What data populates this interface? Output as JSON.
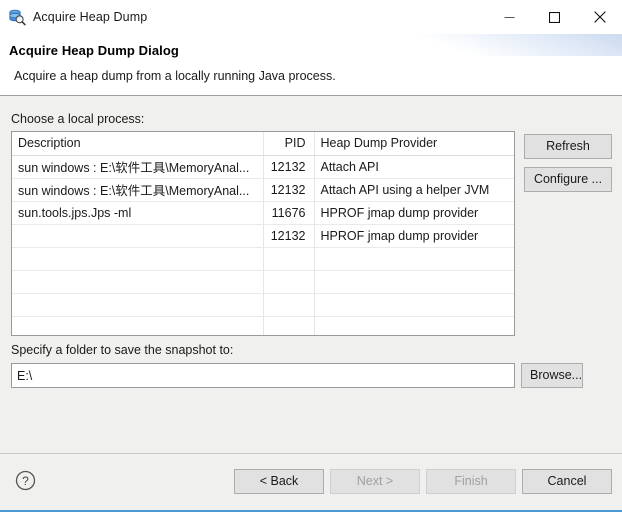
{
  "window": {
    "title": "Acquire Heap Dump",
    "icon": "heap-dump-search-icon",
    "controls": {
      "minimize": "minimize-icon",
      "maximize": "maximize-icon",
      "close": "close-icon"
    }
  },
  "header": {
    "title": "Acquire Heap Dump Dialog",
    "description": "Acquire a heap dump from a locally running Java process."
  },
  "main": {
    "choose_label": "Choose a local process:",
    "table": {
      "columns": [
        "Description",
        "PID",
        "Heap Dump Provider"
      ],
      "rows": [
        {
          "description": "sun windows : E:\\软件工具\\MemoryAnal...",
          "pid": "12132",
          "provider": "Attach API"
        },
        {
          "description": "sun windows : E:\\软件工具\\MemoryAnal...",
          "pid": "12132",
          "provider": "Attach API using a helper JVM"
        },
        {
          "description": "sun.tools.jps.Jps -ml",
          "pid": "11676",
          "provider": "HPROF jmap dump provider"
        },
        {
          "description": "",
          "pid": "12132",
          "provider": "HPROF jmap dump provider"
        }
      ],
      "empty_row_count": 5
    },
    "side_buttons": {
      "refresh": "Refresh",
      "configure": "Configure ..."
    },
    "folder_label": "Specify a folder to save the snapshot to:",
    "folder_value": "E:\\",
    "folder_placeholder": "",
    "browse_label": "Browse..."
  },
  "footer": {
    "help_icon": "help-question-icon",
    "buttons": [
      {
        "label": "< Back",
        "disabled": false
      },
      {
        "label": "Next >",
        "disabled": true
      },
      {
        "label": "Finish",
        "disabled": true
      },
      {
        "label": "Cancel",
        "disabled": false
      }
    ]
  },
  "colors": {
    "accent": "#4a9ad4",
    "window_bg": "#f0f0ef",
    "header_bg": "#ffffff",
    "table_bg": "#ffffff",
    "border": "#9a9a9a",
    "button_face": "#e1e1e1",
    "disabled_text": "#a0a0a0"
  }
}
